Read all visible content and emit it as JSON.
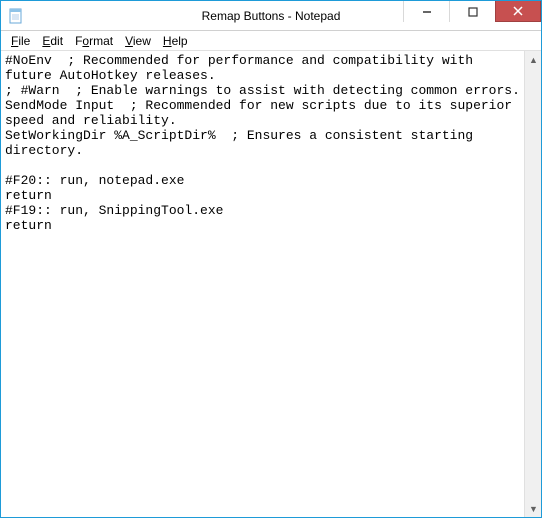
{
  "window": {
    "title": "Remap Buttons - Notepad"
  },
  "menu": {
    "file": "File",
    "edit": "Edit",
    "format": "Format",
    "view": "View",
    "help": "Help"
  },
  "editor": {
    "content": "#NoEnv  ; Recommended for performance and compatibility with future AutoHotkey releases.\n; #Warn  ; Enable warnings to assist with detecting common errors.\nSendMode Input  ; Recommended for new scripts due to its superior speed and reliability.\nSetWorkingDir %A_ScriptDir%  ; Ensures a consistent starting directory.\n\n#F20:: run, notepad.exe\nreturn\n#F19:: run, SnippingTool.exe\nreturn"
  }
}
